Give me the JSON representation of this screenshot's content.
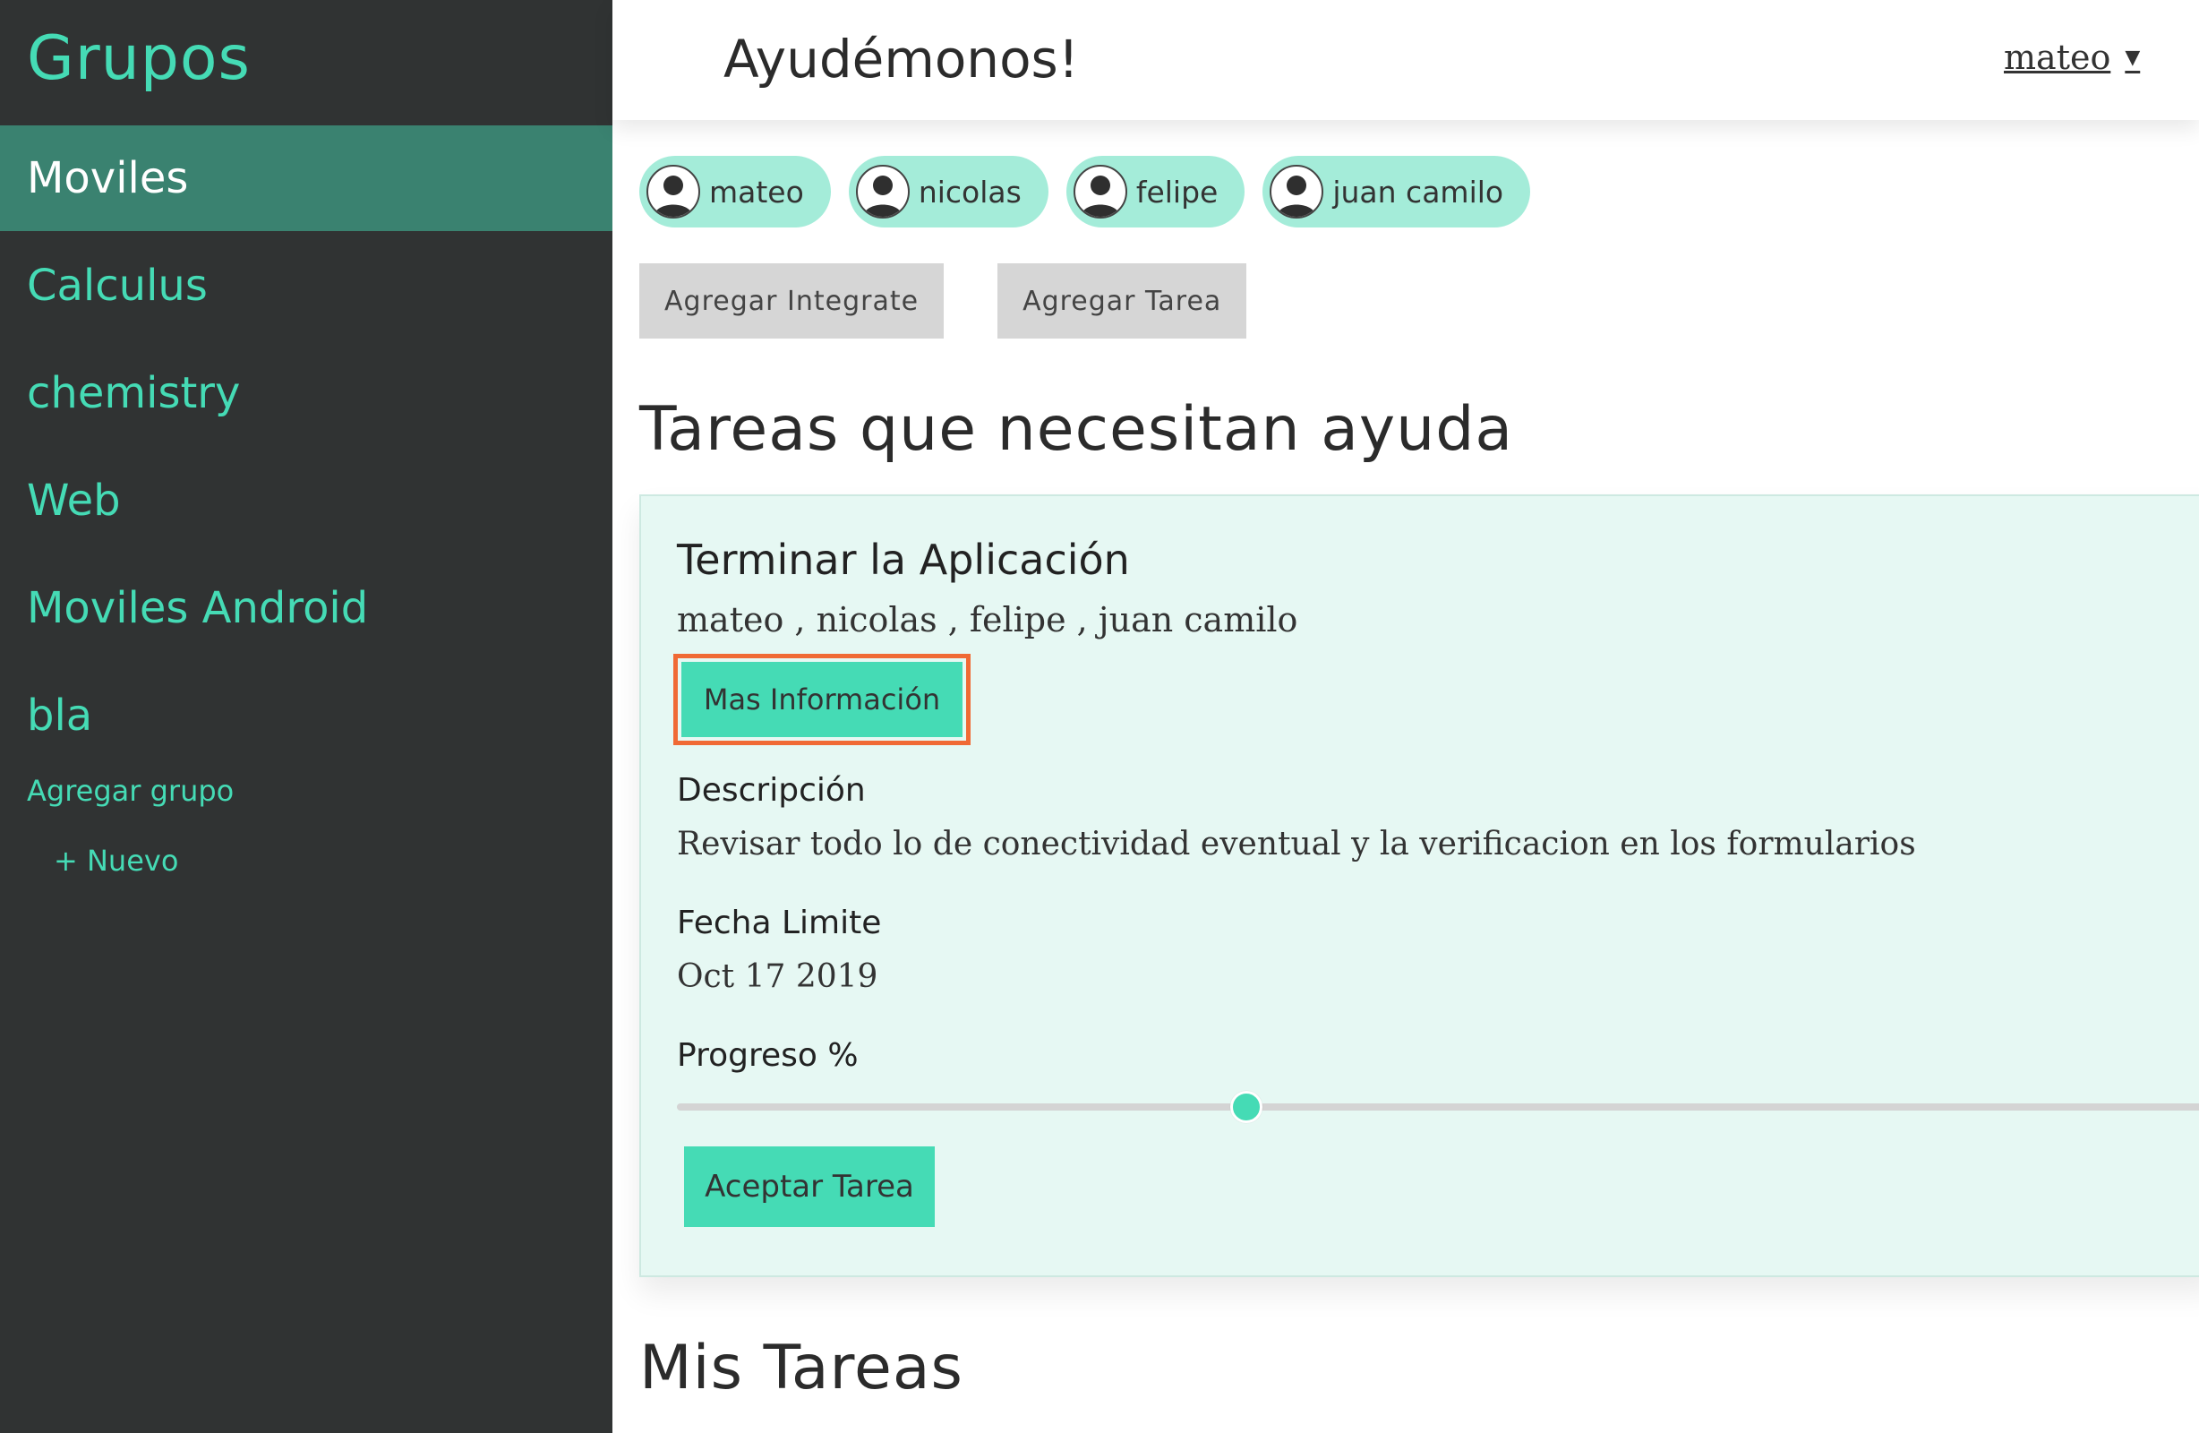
{
  "sidebar": {
    "title": "Grupos",
    "groups": [
      {
        "label": "Moviles",
        "active": true
      },
      {
        "label": "Calculus"
      },
      {
        "label": "chemistry"
      },
      {
        "label": "Web"
      },
      {
        "label": "Moviles Android"
      },
      {
        "label": "bla"
      }
    ],
    "add_group_label": "Agregar grupo",
    "new_label": "+ Nuevo"
  },
  "header": {
    "title": "Ayudémonos!",
    "user": "mateo",
    "caret": "▼"
  },
  "members": [
    "mateo",
    "nicolas",
    "felipe",
    "juan camilo"
  ],
  "actions": {
    "add_member": "Agregar Integrate",
    "add_task": "Agregar Tarea"
  },
  "section_help": "Tareas que necesitan ayuda",
  "section_mine": "Mis Tareas",
  "task": {
    "title": "Terminar la Aplicación",
    "members": "mateo , nicolas , felipe , juan camilo",
    "more_info": "Mas Información",
    "description_label": "Descripción",
    "description": "Revisar todo lo de conectividad eventual y la verificacion en los formularios",
    "deadline_label": "Fecha Limite",
    "deadline": "Oct 17 2019",
    "progress_label": "Progreso %",
    "progress_fraction": 0.37,
    "accept": "Aceptar Tarea"
  },
  "colors": {
    "sidebar_bg": "#303333",
    "accent": "#45dbb5",
    "active_item": "#3a8270",
    "chip_bg": "#a4ecd9",
    "card_bg": "#e6f8f3",
    "highlight": "#f06a35"
  }
}
